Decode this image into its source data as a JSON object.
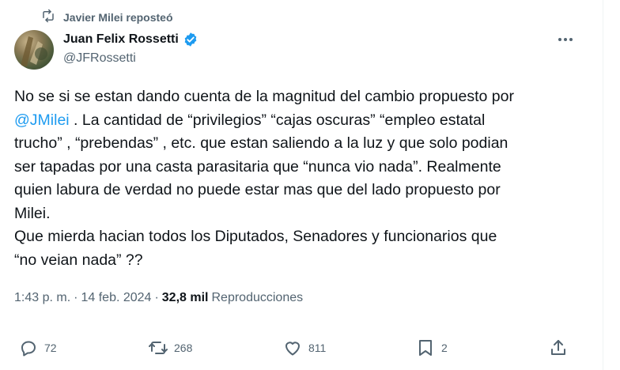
{
  "repost_banner": {
    "icon": "repost-icon",
    "text": "Javier Milei reposteó"
  },
  "author": {
    "name": "Juan Felix Rossetti",
    "handle": "@JFRossetti",
    "verified_icon": "verified-badge-icon",
    "verified_color": "#1d9bf0"
  },
  "tweet": {
    "line1": "No se si se estan dando cuenta de la magnitud del cambio propuesto por",
    "line2_mention": "@JMilei",
    "line2_rest": " . La cantidad de “privilegios” “cajas oscuras” “empleo estatal",
    "line3": "trucho” ,  “prebendas” , etc. que estan saliendo a la luz y que solo podian",
    "line4": "ser tapadas por una casta parasitaria que “nunca vio nada”. Realmente",
    "line5": "quien labura de verdad no puede estar mas que del lado propuesto por",
    "line6": "Milei.",
    "line7": "Que mierda hacian todos los Diputados, Senadores y funcionarios que",
    "line8": "“no veian nada” ??"
  },
  "meta": {
    "time": "1:43 p. m.",
    "separator": "·",
    "date": "14 feb. 2024",
    "views_count": "32,8 mil",
    "views_label": "Reproducciones"
  },
  "actions": {
    "replies": "72",
    "reposts": "268",
    "likes": "811",
    "bookmarks": "2"
  },
  "colors": {
    "text": "#0f1419",
    "secondary": "#536471",
    "accent": "#1d9bf0"
  }
}
